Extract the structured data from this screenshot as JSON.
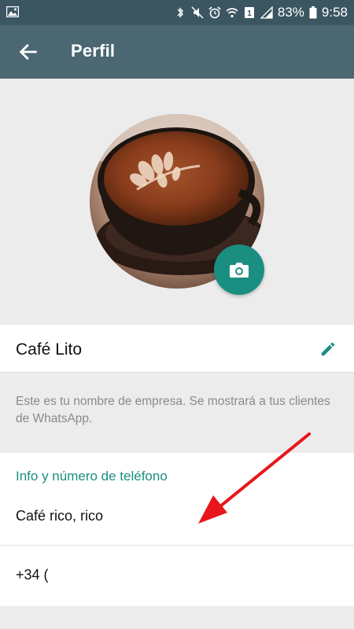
{
  "status_bar": {
    "battery": "83%",
    "time": "9:58",
    "icons": [
      "image-icon",
      "bluetooth-icon",
      "mute-icon",
      "alarm-icon",
      "wifi-icon",
      "sim-icon",
      "signal-icon",
      "battery-icon"
    ]
  },
  "app_bar": {
    "title": "Perfil",
    "back_icon": "arrow-back-icon"
  },
  "profile": {
    "photo_description_icon": "camera-icon",
    "business_name": "Café Lito",
    "edit_icon": "pencil-icon",
    "name_hint": "Este es tu nombre de empresa. Se mostrará a tus clientes de WhatsApp."
  },
  "info": {
    "header": "Info y número de teléfono",
    "description": "Café rico, rico",
    "phone": "+34 ("
  },
  "colors": {
    "status_bar": "#3b5661",
    "app_bar": "#4a6772",
    "accent": "#1a8f81",
    "annotation_arrow": "#e8161b"
  }
}
